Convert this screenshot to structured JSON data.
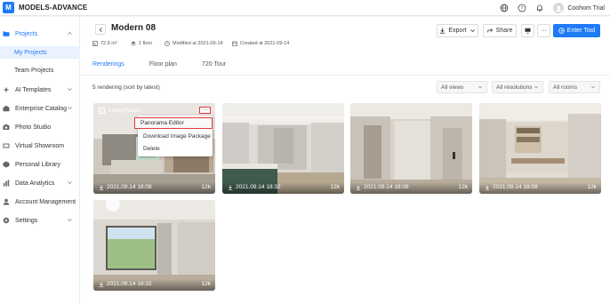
{
  "app": {
    "logo_letter": "M",
    "name": "MODELS-ADVANCE"
  },
  "topbar": {
    "icons": [
      "globe-icon",
      "help-icon",
      "bell-icon"
    ],
    "user_name": "Coohom Trial"
  },
  "sidebar": {
    "items": [
      {
        "label": "Projects",
        "icon": "folder-icon",
        "expanded": true
      },
      {
        "label": "My Projects",
        "sub": true,
        "active": true
      },
      {
        "label": "Team Projects",
        "sub": true
      },
      {
        "label": "AI Templates",
        "icon": "ai-icon",
        "has_chevron": true
      },
      {
        "label": "Enterprise Catalog",
        "icon": "catalog-icon",
        "has_chevron": true
      },
      {
        "label": "Photo Studio",
        "icon": "camera-icon"
      },
      {
        "label": "Virtual Showroom",
        "icon": "showroom-icon"
      },
      {
        "label": "Personal Library",
        "icon": "library-icon"
      },
      {
        "label": "Data Analytics",
        "icon": "analytics-icon",
        "has_chevron": true
      },
      {
        "label": "Account Management",
        "icon": "account-icon"
      },
      {
        "label": "Settings",
        "icon": "settings-icon",
        "has_chevron": true
      }
    ]
  },
  "header": {
    "title": "Modern 08",
    "meta": {
      "area": "72.9 m²",
      "floors": "1 floor",
      "modified": "Modified at 2021-09-14",
      "created": "Created at 2021-09-14"
    },
    "buttons": {
      "export": "Export",
      "share": "Share",
      "more": "···",
      "enter_tool": "Enter Tool"
    }
  },
  "tabs": [
    {
      "label": "Renderings",
      "active": true
    },
    {
      "label": "Floor plan"
    },
    {
      "label": "720 Tour"
    }
  ],
  "list": {
    "count_text": "5 rendering (sort by latest)",
    "filters": [
      "All views",
      "All resolutions",
      "All rooms"
    ]
  },
  "cards": [
    {
      "label": "Living Room",
      "date": "2021.09.14 18:08",
      "size": "12k",
      "scene": "living-room",
      "menu_open": true
    },
    {
      "date": "2021.09.14 18:32",
      "size": "12k",
      "scene": "bedroom"
    },
    {
      "date": "2021.09.14 18:08",
      "size": "12k",
      "scene": "hallway"
    },
    {
      "date": "2021.09.14 18:08",
      "size": "12k",
      "scene": "study"
    },
    {
      "date": "2021.09.14 18:32",
      "size": "12k",
      "scene": "window-room"
    }
  ],
  "card_menu": {
    "more_label": "···",
    "items": [
      "Panorama Editor",
      "Download Image Package",
      "Delete"
    ]
  },
  "colors": {
    "accent": "#1e7bf6",
    "highlight": "#e23b3b"
  }
}
